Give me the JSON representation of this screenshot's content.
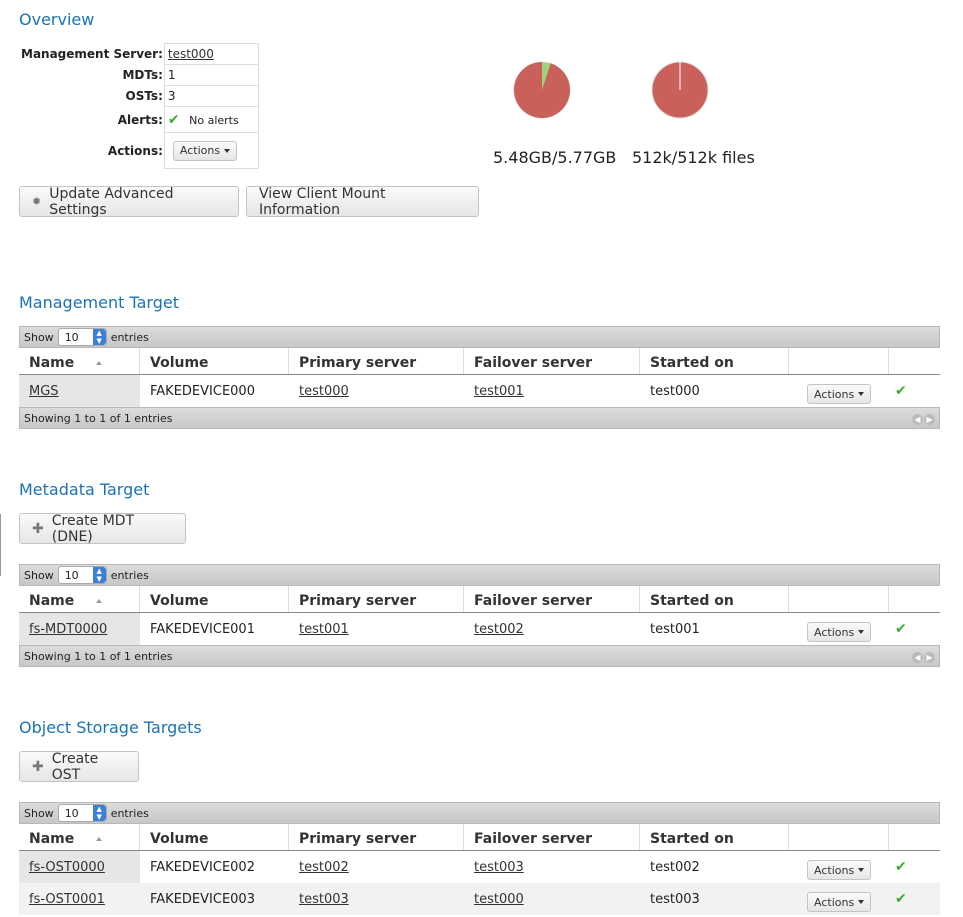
{
  "overview": {
    "title": "Overview",
    "rows": {
      "mgs_label": "Management Server:",
      "mgs_value": "test000",
      "mdts_label": "MDTs:",
      "mdts_value": "1",
      "osts_label": "OSTs:",
      "osts_value": "3",
      "alerts_label": "Alerts:",
      "alerts_value": "No alerts",
      "actions_label": "Actions:",
      "actions_button": "Actions"
    },
    "space_caption": "5.48GB/5.77GB",
    "files_caption": "512k/512k files",
    "space_used_fraction": 0.95,
    "files_used_fraction": 1.0,
    "pie_used_color": "#c9605a",
    "pie_free_color": "#9fd07a",
    "update_button": "Update Advanced Settings",
    "mount_button": "View Client Mount Information"
  },
  "common": {
    "show": "Show",
    "entries": "entries",
    "page_size": "10",
    "columns": [
      "Name",
      "Volume",
      "Primary server",
      "Failover server",
      "Started on"
    ],
    "actions": "Actions"
  },
  "mgt": {
    "title": "Management Target",
    "rows": [
      {
        "name": "MGS",
        "volume": "FAKEDEVICE000",
        "primary": "test000",
        "failover": "test001",
        "started": "test000"
      }
    ],
    "footer": "Showing 1 to 1 of 1 entries"
  },
  "mdt": {
    "title": "Metadata Target",
    "create_button": "Create MDT (DNE)",
    "rows": [
      {
        "name": "fs-MDT0000",
        "volume": "FAKEDEVICE001",
        "primary": "test001",
        "failover": "test002",
        "started": "test001"
      }
    ],
    "footer": "Showing 1 to 1 of 1 entries"
  },
  "ost": {
    "title": "Object Storage Targets",
    "create_button": "Create OST",
    "rows": [
      {
        "name": "fs-OST0000",
        "volume": "FAKEDEVICE002",
        "primary": "test002",
        "failover": "test003",
        "started": "test002"
      },
      {
        "name": "fs-OST0001",
        "volume": "FAKEDEVICE003",
        "primary": "test003",
        "failover": "test000",
        "started": "test003"
      }
    ]
  }
}
